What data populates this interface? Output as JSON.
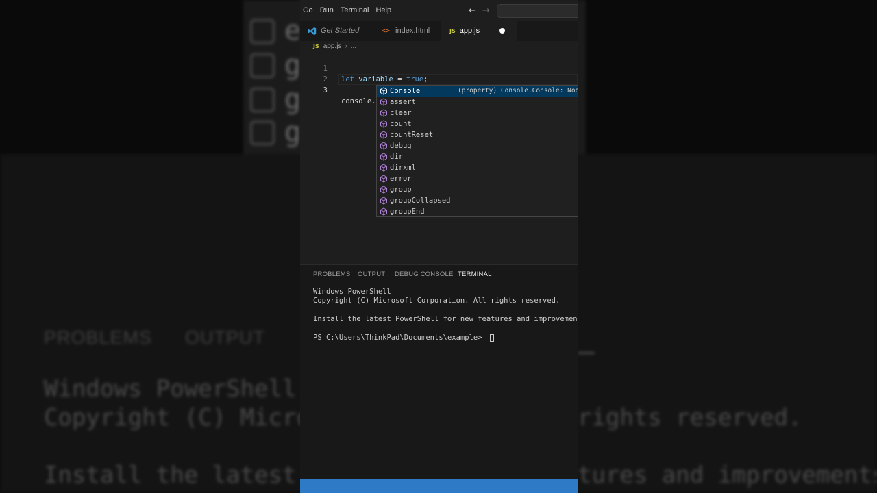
{
  "menu": {
    "items": [
      "Go",
      "Run",
      "Terminal",
      "Help"
    ]
  },
  "tabs": [
    {
      "label": "Get Started"
    },
    {
      "label": "index.html"
    },
    {
      "label": "app.js"
    }
  ],
  "breadcrumb": {
    "file": "app.js",
    "rest": "..."
  },
  "editor": {
    "lines": [
      {
        "number": "1",
        "keyword": "let",
        "variable": "variable",
        "op": " = ",
        "value": "true",
        "end": ";"
      },
      {
        "number": "2"
      },
      {
        "number": "3",
        "text": "console."
      }
    ]
  },
  "suggest": {
    "items": [
      "Console",
      "assert",
      "clear",
      "count",
      "countReset",
      "debug",
      "dir",
      "dirxml",
      "error",
      "group",
      "groupCollapsed",
      "groupEnd"
    ],
    "selected_detail": "(property) Console.Console: Node"
  },
  "panel": {
    "tabs": [
      "PROBLEMS",
      "OUTPUT",
      "DEBUG CONSOLE",
      "TERMINAL"
    ],
    "terminal": [
      "Windows PowerShell",
      "Copyright (C) Microsoft Corporation. All rights reserved.",
      "Install the latest PowerShell for new features and improvements!",
      "PS C:\\Users\\ThinkPad\\Documents\\example> "
    ]
  },
  "background": {
    "letters": [
      "e",
      "g",
      "g",
      "g"
    ],
    "tabs": [
      "PROBLEMS",
      "OUTPUT"
    ],
    "term_left": [
      "Windows PowerShell",
      "Copyright (C) Micros",
      "Install the latest P"
    ],
    "term_right": [
      "rights reserved.",
      "tures and improvements!"
    ]
  },
  "colors": {
    "statusbar": "#2f7ac6",
    "selection": "#04395e",
    "editor_bg": "#1e1e1e"
  }
}
